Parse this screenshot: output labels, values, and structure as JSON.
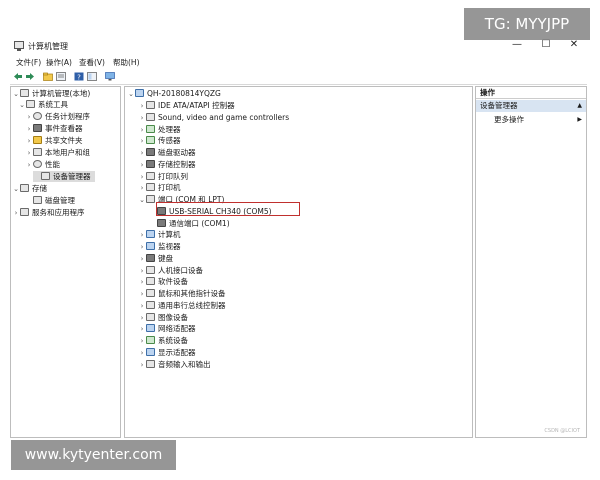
{
  "window": {
    "title": "计算机管理",
    "controls": {
      "minimize": "—",
      "maximize": "☐",
      "close": "✕"
    }
  },
  "menu": [
    "文件(F)",
    "操作(A)",
    "查看(V)",
    "帮助(H)"
  ],
  "toolbar": {
    "icons": [
      "back-arrow-icon",
      "forward-arrow-icon",
      "folder-up-icon",
      "properties-icon",
      "help-icon",
      "console-icon",
      "monitor-icon"
    ]
  },
  "left_tree": [
    {
      "label": "计算机管理(本地)",
      "expand": "⌄",
      "icon": "computer-management-icon"
    },
    {
      "label": "系统工具",
      "expand": "⌄",
      "icon": "tools-icon"
    },
    {
      "label": "任务计划程序",
      "expand": "›",
      "icon": "clock-icon"
    },
    {
      "label": "事件查看器",
      "expand": "›",
      "icon": "event-viewer-icon"
    },
    {
      "label": "共享文件夹",
      "expand": "›",
      "icon": "shared-folder-icon"
    },
    {
      "label": "本地用户和组",
      "expand": "›",
      "icon": "users-icon"
    },
    {
      "label": "性能",
      "expand": "›",
      "icon": "performance-icon"
    },
    {
      "label": "设备管理器",
      "expand": "",
      "icon": "device-manager-icon"
    },
    {
      "label": "存储",
      "expand": "⌄",
      "icon": "storage-icon"
    },
    {
      "label": "磁盘管理",
      "expand": "",
      "icon": "disk-icon"
    },
    {
      "label": "服务和应用程序",
      "expand": "›",
      "icon": "services-icon"
    }
  ],
  "device_tree": {
    "root": "QH-20180814YQZG",
    "items": [
      {
        "label": "IDE ATA/ATAPI 控制器",
        "expand": "›",
        "icon": "ide-controller-icon"
      },
      {
        "label": "Sound, video and game controllers",
        "expand": "›",
        "icon": "sound-icon"
      },
      {
        "label": "处理器",
        "expand": "›",
        "icon": "processor-icon"
      },
      {
        "label": "传感器",
        "expand": "›",
        "icon": "sensor-icon"
      },
      {
        "label": "磁盘驱动器",
        "expand": "›",
        "icon": "disk-drive-icon"
      },
      {
        "label": "存储控制器",
        "expand": "›",
        "icon": "storage-controller-icon"
      },
      {
        "label": "打印队列",
        "expand": "›",
        "icon": "print-queue-icon"
      },
      {
        "label": "打印机",
        "expand": "›",
        "icon": "printer-icon"
      },
      {
        "label": "端口 (COM 和 LPT)",
        "expand": "⌄",
        "icon": "port-icon"
      },
      {
        "label": "USB-SERIAL CH340 (COM5)",
        "expand": "",
        "icon": "port-device-icon",
        "child": true
      },
      {
        "label": "通信端口 (COM1)",
        "expand": "",
        "icon": "port-device-icon",
        "child": true
      },
      {
        "label": "计算机",
        "expand": "›",
        "icon": "computer-icon"
      },
      {
        "label": "监视器",
        "expand": "›",
        "icon": "monitor-icon"
      },
      {
        "label": "键盘",
        "expand": "›",
        "icon": "keyboard-icon"
      },
      {
        "label": "人机接口设备",
        "expand": "›",
        "icon": "hid-icon"
      },
      {
        "label": "软件设备",
        "expand": "›",
        "icon": "software-device-icon"
      },
      {
        "label": "鼠标和其他指针设备",
        "expand": "›",
        "icon": "mouse-icon"
      },
      {
        "label": "通用串行总线控制器",
        "expand": "›",
        "icon": "usb-icon"
      },
      {
        "label": "图像设备",
        "expand": "›",
        "icon": "camera-icon"
      },
      {
        "label": "网络适配器",
        "expand": "›",
        "icon": "network-adapter-icon"
      },
      {
        "label": "系统设备",
        "expand": "›",
        "icon": "system-device-icon"
      },
      {
        "label": "显示适配器",
        "expand": "›",
        "icon": "display-adapter-icon"
      },
      {
        "label": "音频输入和输出",
        "expand": "›",
        "icon": "audio-icon"
      }
    ]
  },
  "actions": {
    "header": "操作",
    "section": "设备管理器",
    "section_caret": "▲",
    "more": "更多操作",
    "more_caret": "▶"
  },
  "overlays": {
    "tg": "TG: MYYJPP",
    "site": "www.kytyenter.com",
    "csdn": "CSDN @LCIOT"
  },
  "colors": {
    "highlight_border": "#c0302e",
    "selected_bg": "#d8e4f2"
  }
}
